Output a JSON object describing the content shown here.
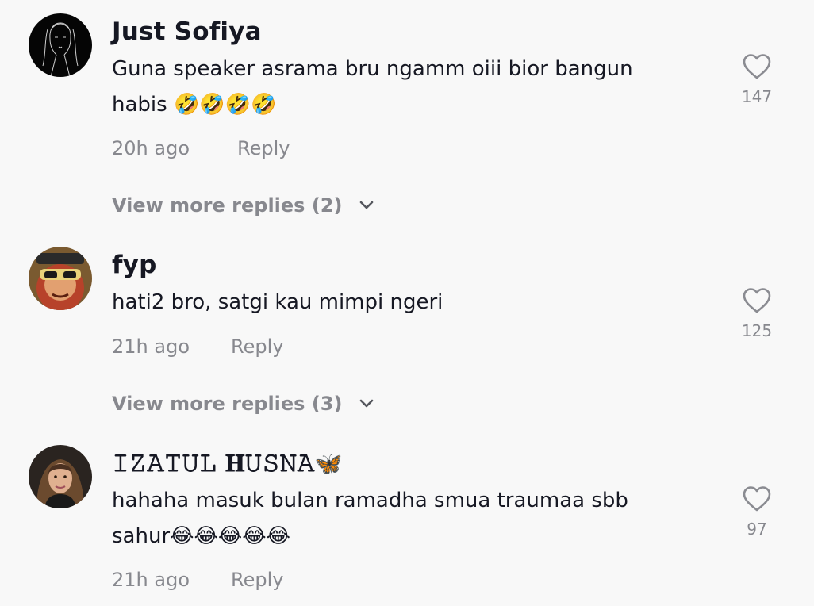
{
  "comments": [
    {
      "username": "Just Sofiya",
      "username_emoji": "",
      "text": "Guna speaker asrama bru ngamm oiii bior bangun habis 🤣🤣🤣🤣",
      "time": "20h ago",
      "reply_label": "Reply",
      "likes": "147",
      "view_more": "View more replies (2)",
      "avatar_icon": "line-art-portrait"
    },
    {
      "username": "fyp",
      "username_emoji": "",
      "text": "hati2 bro, satgi kau mimpi ngeri",
      "time": "21h ago",
      "reply_label": "Reply",
      "likes": "125",
      "view_more": "View more replies (3)",
      "avatar_icon": "cartoon-face-with-sunglasses"
    },
    {
      "username": "𝙸𝚉𝙰𝚃𝚄𝙻 𝐇𝚄𝚂𝙽𝙰",
      "username_emoji": "🦋",
      "text": "hahaha masuk bulan ramadha smua traumaa sbb sahur😂😂😂😂😂",
      "time": "21h ago",
      "reply_label": "Reply",
      "likes": "97",
      "view_more": "",
      "avatar_icon": "photo-portrait"
    }
  ],
  "colors": {
    "background": "#f8f8f8",
    "primary_text": "#161823",
    "secondary_text": "#8a8b91"
  },
  "icons": {
    "like": "heart-outline-icon",
    "expand": "chevron-down-icon"
  }
}
